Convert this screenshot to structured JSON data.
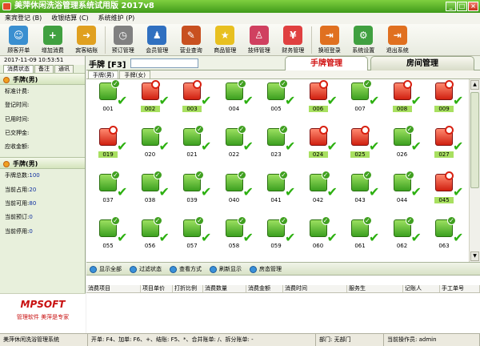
{
  "window": {
    "title": "美萍休闲洗浴管理系统试用版 2017v8"
  },
  "menu": [
    "来宾登记 (B)",
    "收银结算 (C)",
    "系统维护 (P)"
  ],
  "toolbar": [
    {
      "label": "顾客开单",
      "icon": "customer-icon",
      "color": "#3a8fd0"
    },
    {
      "label": "增加消费",
      "icon": "add-cross-icon",
      "color": "#40a040"
    },
    {
      "label": "宾客结账",
      "icon": "checkout-arrow-icon",
      "color": "#e0a020"
    },
    {
      "label": "预订管理",
      "icon": "clock-icon",
      "color": "#808080"
    },
    {
      "label": "会员管理",
      "icon": "members-icon",
      "color": "#3070c0"
    },
    {
      "label": "营业查询",
      "icon": "pencil-icon",
      "color": "#c85020"
    },
    {
      "label": "商品管理",
      "icon": "star-icon",
      "color": "#e8c020"
    },
    {
      "label": "技师管理",
      "icon": "technician-icon",
      "color": "#d04060"
    },
    {
      "label": "财务管理",
      "icon": "finance-icon",
      "color": "#e04040"
    },
    {
      "label": "换班登录",
      "icon": "exit-door-icon",
      "color": "#e07020"
    },
    {
      "label": "系统设置",
      "icon": "gear-icon",
      "color": "#40a040"
    },
    {
      "label": "退出系统",
      "icon": "exit-door-icon",
      "color": "#e07020"
    }
  ],
  "left": {
    "datetime": "2017-11-09  10:53:51",
    "tabs": [
      "消费状态",
      "备注",
      "通讯"
    ],
    "section1": {
      "title": "手牌(男)",
      "rows": [
        {
          "k": "标准计费:",
          "v": ""
        },
        {
          "k": "登记时间:",
          "v": ""
        },
        {
          "k": "已用时间:",
          "v": ""
        },
        {
          "k": "已交押金:",
          "v": ""
        },
        {
          "k": "应收金额:",
          "v": ""
        }
      ]
    },
    "section2": {
      "title": "手牌(男)",
      "rows": [
        {
          "k": "手牌总数:",
          "v": "100"
        },
        {
          "k": "当前占用:",
          "v": "20"
        },
        {
          "k": "当前可用:",
          "v": "80"
        },
        {
          "k": "当前预订:",
          "v": "0"
        },
        {
          "k": "当前停用:",
          "v": "0"
        }
      ]
    },
    "brand": {
      "logo": "MPSOFT",
      "slogan": "管理软件  美萍是专家"
    }
  },
  "main": {
    "title": "手牌 [F3]",
    "search_value": "",
    "tab_active": "手牌管理",
    "tab_other": "房间管理",
    "subtabs": [
      "手牌(男)",
      "手牌(女)"
    ],
    "rooms": [
      {
        "n": "001",
        "s": "free"
      },
      {
        "n": "002",
        "s": "occ"
      },
      {
        "n": "003",
        "s": "occ"
      },
      {
        "n": "004",
        "s": "free"
      },
      {
        "n": "005",
        "s": "free"
      },
      {
        "n": "006",
        "s": "occ"
      },
      {
        "n": "007",
        "s": "free"
      },
      {
        "n": "008",
        "s": "occ"
      },
      {
        "n": "009",
        "s": "occ"
      },
      {
        "n": "019",
        "s": "occ"
      },
      {
        "n": "020",
        "s": "free"
      },
      {
        "n": "021",
        "s": "free"
      },
      {
        "n": "022",
        "s": "free"
      },
      {
        "n": "023",
        "s": "free"
      },
      {
        "n": "024",
        "s": "occ"
      },
      {
        "n": "025",
        "s": "occ"
      },
      {
        "n": "026",
        "s": "free"
      },
      {
        "n": "027",
        "s": "occ"
      },
      {
        "n": "037",
        "s": "free"
      },
      {
        "n": "038",
        "s": "free"
      },
      {
        "n": "039",
        "s": "free"
      },
      {
        "n": "040",
        "s": "free"
      },
      {
        "n": "041",
        "s": "free"
      },
      {
        "n": "042",
        "s": "free"
      },
      {
        "n": "043",
        "s": "free"
      },
      {
        "n": "044",
        "s": "free"
      },
      {
        "n": "045",
        "s": "occ"
      },
      {
        "n": "055",
        "s": "free"
      },
      {
        "n": "056",
        "s": "free"
      },
      {
        "n": "057",
        "s": "free"
      },
      {
        "n": "058",
        "s": "free"
      },
      {
        "n": "059",
        "s": "free"
      },
      {
        "n": "060",
        "s": "free"
      },
      {
        "n": "061",
        "s": "free"
      },
      {
        "n": "062",
        "s": "free"
      },
      {
        "n": "063",
        "s": "free"
      }
    ],
    "actions": [
      "显示全部",
      "过滤状态",
      "查看方式",
      "刷新显示",
      "房态管理"
    ],
    "table_headers": [
      "消费项目",
      "项目单价",
      "打折比例",
      "消费数量",
      "消费金额",
      "消费时间",
      "服务生",
      "记账人",
      "手工单号"
    ]
  },
  "status": {
    "app": "美萍休闲洗浴管理系统",
    "hint": "开单: F4、加单: F6、+、结账: F5、*、合并账单: /、拆分账单: -",
    "dept": "部门: 无部门",
    "operator": "当前操作员: admin"
  }
}
